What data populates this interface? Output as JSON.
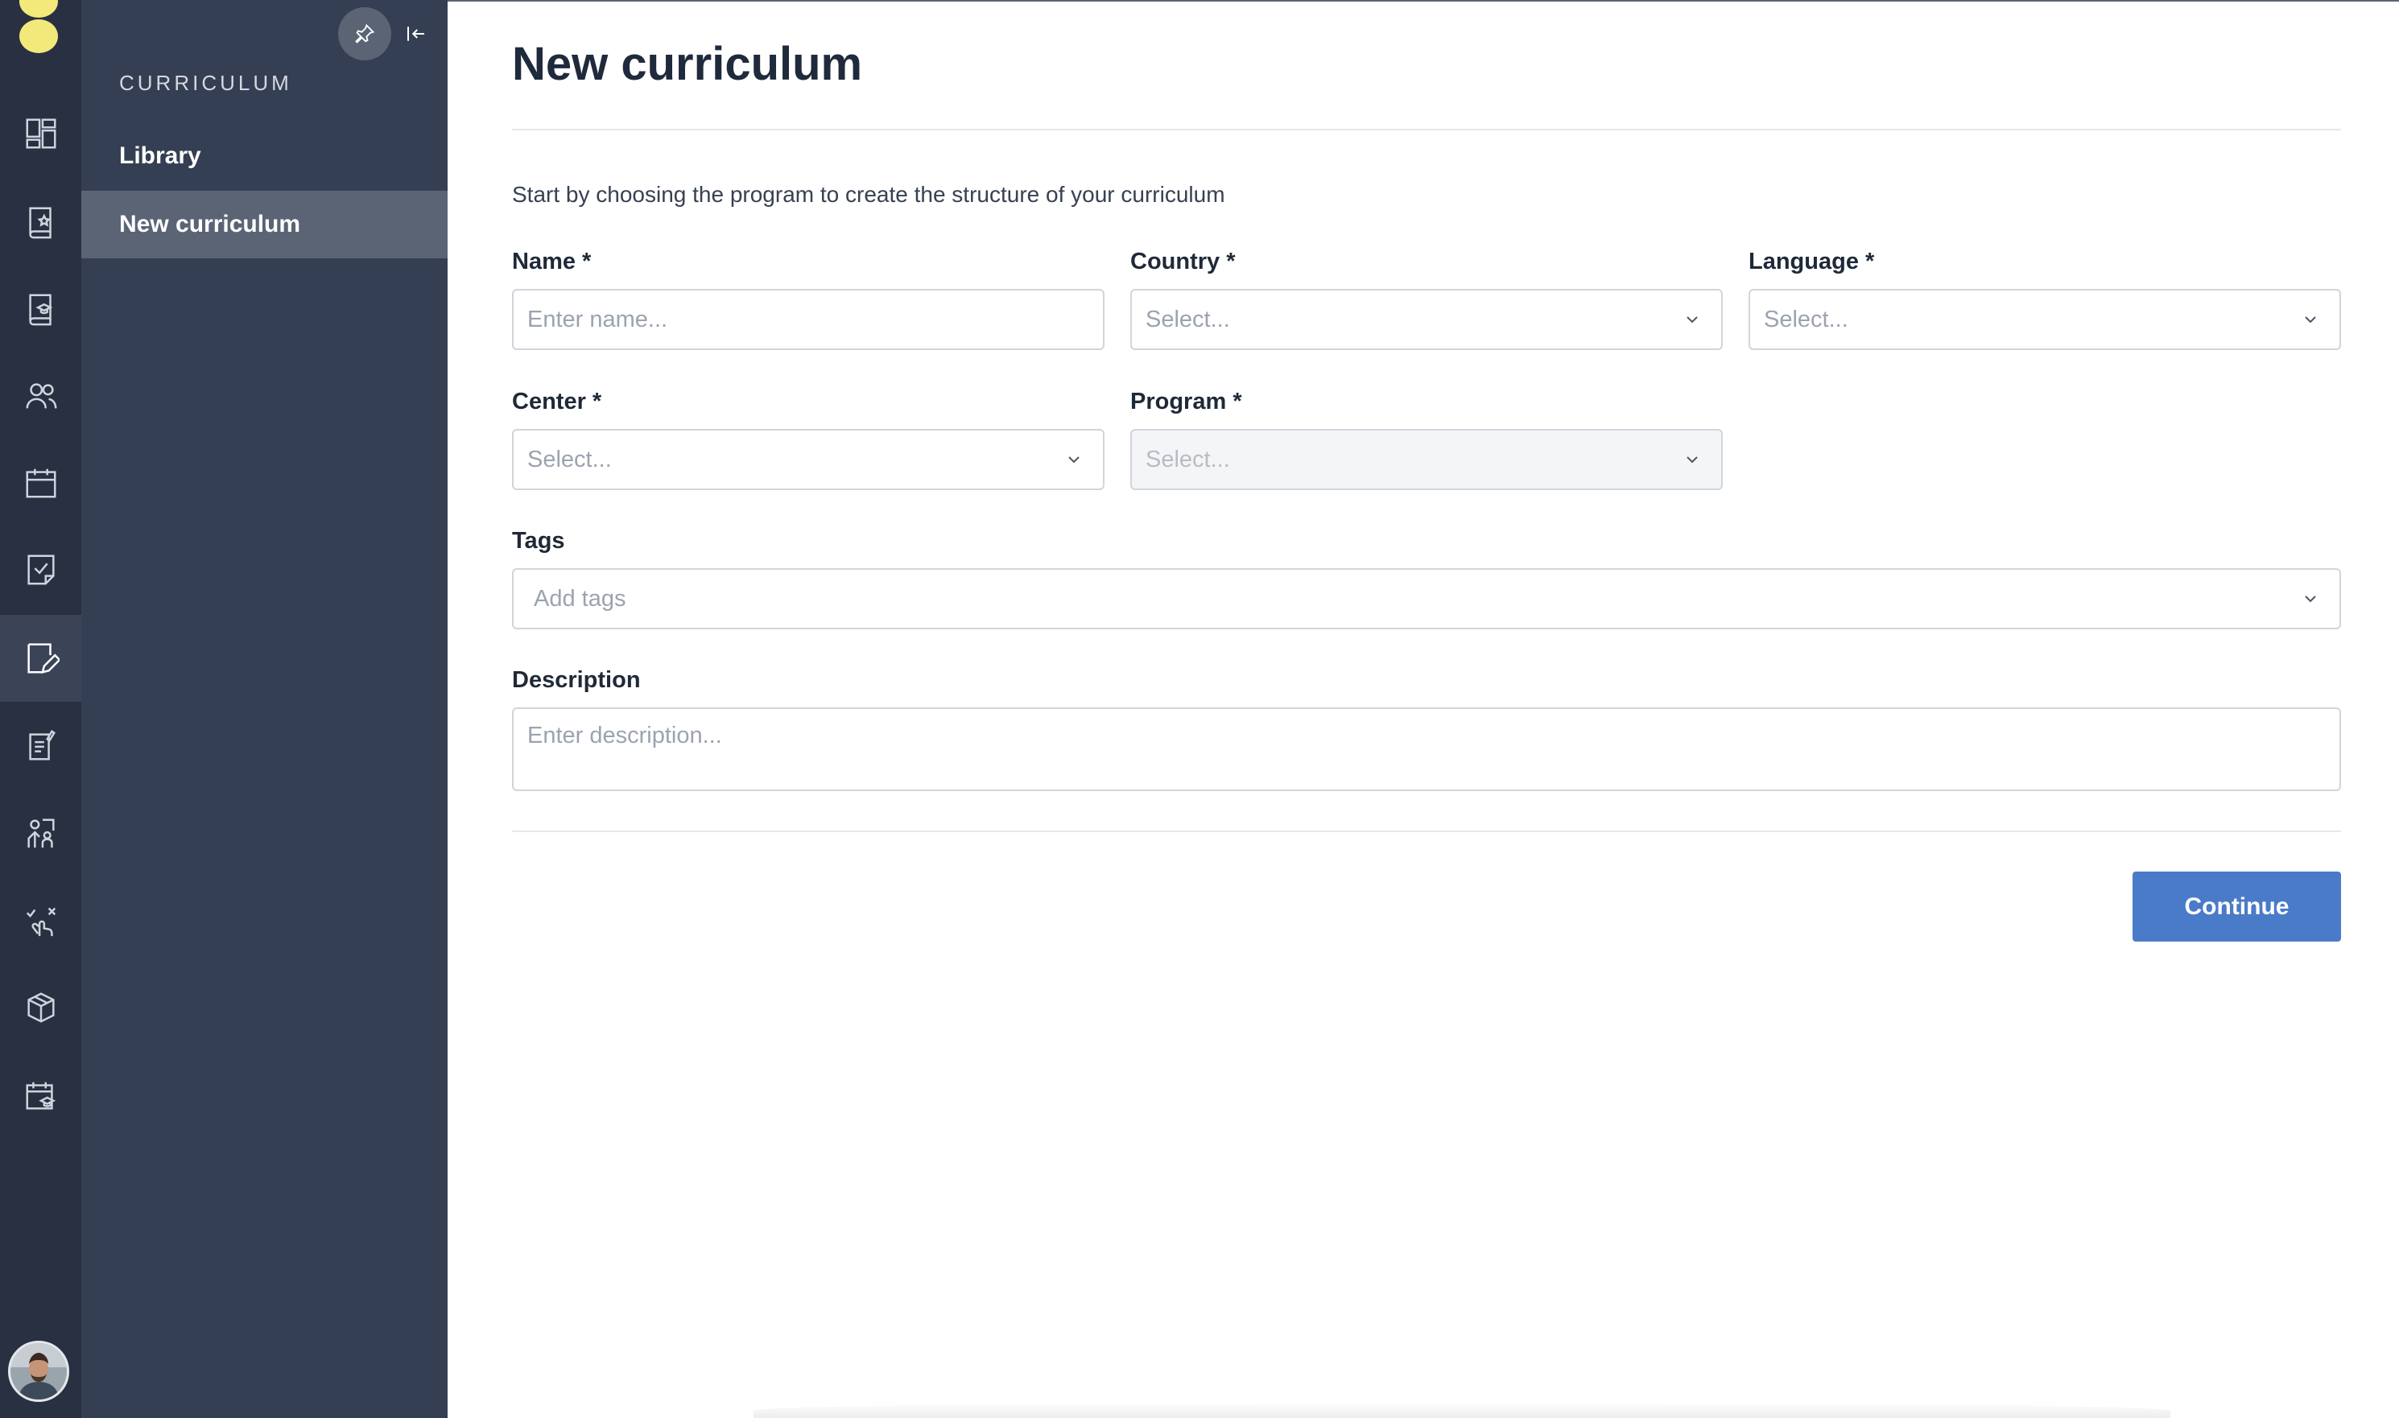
{
  "sidebar": {
    "heading": "CURRICULUM",
    "items": [
      {
        "label": "Library"
      },
      {
        "label": "New curriculum"
      }
    ]
  },
  "rail": {
    "icons": [
      "dashboard-icon",
      "book-star-icon",
      "book-graduation-icon",
      "users-icon",
      "calendar-icon",
      "checklist-icon",
      "edit-document-icon",
      "edit-list-icon",
      "group-learning-icon",
      "tap-gesture-icon",
      "box-icon",
      "calendar-graduation-icon"
    ],
    "active_index": 6
  },
  "page": {
    "title": "New curriculum",
    "intro": "Start by choosing the program to create the structure of your curriculum"
  },
  "form": {
    "name": {
      "label": "Name *",
      "placeholder": "Enter name..."
    },
    "country": {
      "label": "Country *",
      "placeholder": "Select..."
    },
    "language": {
      "label": "Language *",
      "placeholder": "Select..."
    },
    "center": {
      "label": "Center *",
      "placeholder": "Select..."
    },
    "program": {
      "label": "Program *",
      "placeholder": "Select..."
    },
    "tags": {
      "label": "Tags",
      "placeholder": "Add tags"
    },
    "description": {
      "label": "Description",
      "placeholder": "Enter description..."
    }
  },
  "actions": {
    "continue_label": "Continue"
  },
  "colors": {
    "rail_bg": "#283042",
    "subnav_bg": "#353f53",
    "accent": "#4a7bc8",
    "logo": "#f2e97a"
  }
}
